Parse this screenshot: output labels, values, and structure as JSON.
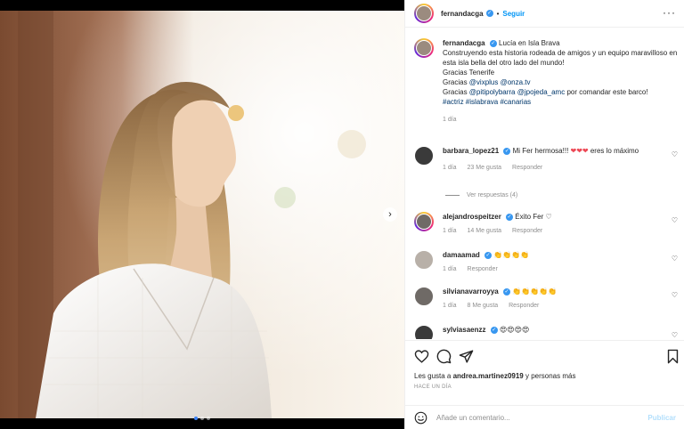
{
  "post": {
    "author": "fernandacga",
    "follow_label": "Seguir",
    "separator": "•",
    "more_label": "···",
    "next_label": "›"
  },
  "caption": {
    "author": "fernandacga",
    "location": "Lucía en Isla Brava",
    "text_1": "Construyendo esta historia rodeada de amigos y un equipo maravilloso en esta isla bella del otro lado del mundo!",
    "text_2": "Gracias Tenerife",
    "text_3_prefix": "Gracias ",
    "mention_1": "@vixplus",
    "mention_2": "@onza.tv",
    "text_4_prefix": "Gracias ",
    "mention_3": "@pitipolybarra",
    "mention_4": "@jpojeda_amc",
    "text_4_suffix": " por comandar este barco!",
    "hashtags": "#actriz #islabrava #canarias",
    "time": "1 día"
  },
  "comments": [
    {
      "user": "barbara_lopez21",
      "text": "Mi Fer hermosa!!! ",
      "hearts": "❤❤❤",
      "text_after": " eres lo máximo",
      "time": "1 día",
      "likes": "23 Me gusta",
      "reply": "Responder",
      "view_replies": "Ver respuestas (4)"
    },
    {
      "user": "alejandrospeitzer",
      "text": "Éxito Fer ♡",
      "time": "1 día",
      "likes": "14 Me gusta",
      "reply": "Responder"
    },
    {
      "user": "damaamad",
      "text": "👏👏👏👏",
      "time": "1 día",
      "reply": "Responder"
    },
    {
      "user": "silvianavarroyya",
      "text": "👏👏👏👏👏",
      "time": "1 día",
      "likes": "8 Me gusta",
      "reply": "Responder"
    },
    {
      "user": "sylviasaenzz",
      "text": "😍😍😍😍",
      "time": "",
      "reply": ""
    }
  ],
  "actions": {
    "likes_prefix": "Les gusta a ",
    "likes_user": "andrea.martinez0919",
    "likes_suffix": " y personas más",
    "ago": "HACE UN DÍA",
    "comment_placeholder": "Añade un comentario...",
    "publish_label": "Publicar"
  },
  "icons": {
    "like": "heart-outline-icon",
    "comment": "comment-bubble-icon",
    "share": "paper-plane-icon",
    "save": "bookmark-icon",
    "emoji": "smiley-icon"
  },
  "carousel": {
    "slides": 3,
    "active": 1
  },
  "colors": {
    "accent": "#0095f6",
    "verified": "#3897f0",
    "link": "#00376b",
    "muted": "#8e8e8e"
  }
}
